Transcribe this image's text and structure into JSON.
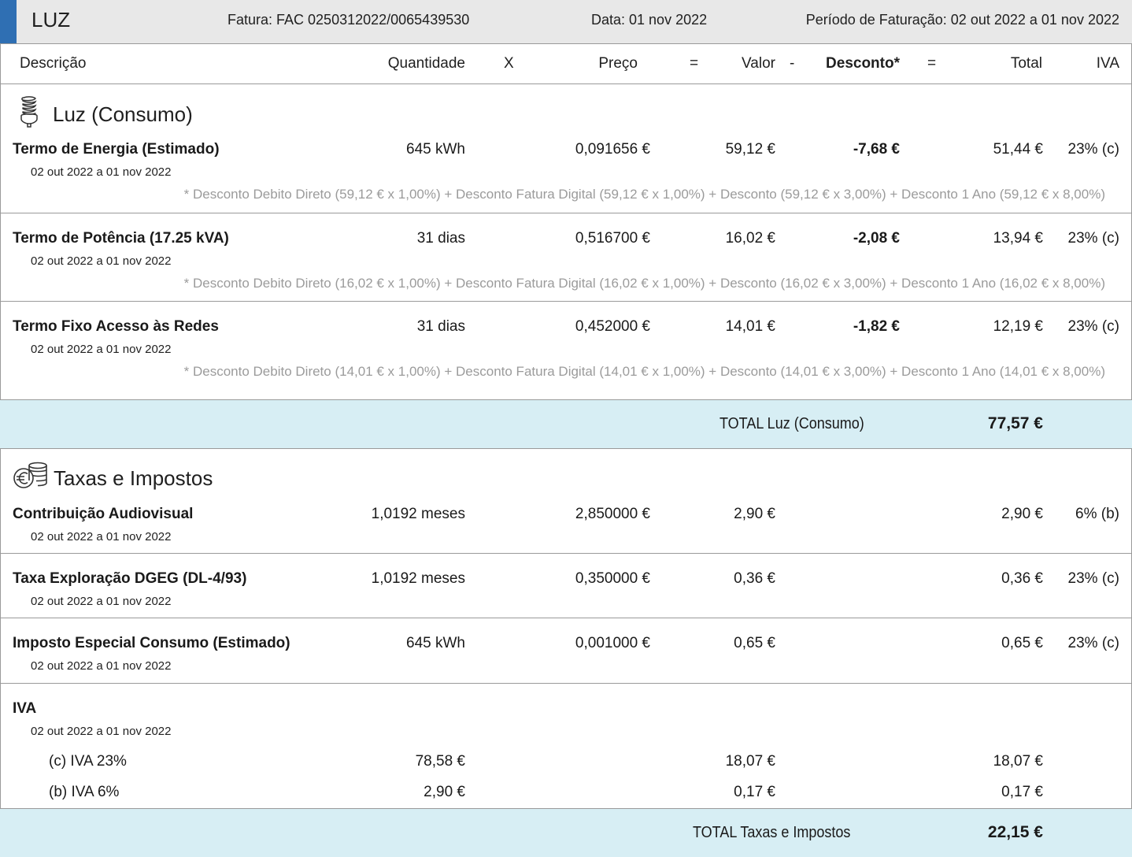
{
  "header": {
    "title": "LUZ",
    "invoice": "Fatura: FAC 0250312022/0065439530",
    "date": "Data: 01 nov 2022",
    "period": "Período de Faturação:  02 out 2022 a 01 nov 2022"
  },
  "columns": {
    "description": "Descrição",
    "quantity": "Quantidade",
    "times": "X",
    "price": "Preço",
    "eq1": "=",
    "value": "Valor",
    "minus": "-",
    "discount": "Desconto*",
    "eq2": "=",
    "total": "Total",
    "iva": "IVA"
  },
  "consumo": {
    "title": "Luz (Consumo)",
    "icon": "lightbulb-icon",
    "rows": [
      {
        "name": "Termo de Energia (Estimado)",
        "period": "02 out 2022 a 01 nov 2022",
        "quantity": "645 kWh",
        "price": "0,091656 €",
        "value": "59,12 €",
        "discount": "-7,68 €",
        "total": "51,44 €",
        "iva": "23% (c)",
        "note": "* Desconto Debito Direto (59,12 € x 1,00%) + Desconto Fatura Digital (59,12 € x 1,00%) + Desconto (59,12 € x 3,00%) + Desconto 1 Ano (59,12 € x 8,00%)"
      },
      {
        "name": "Termo de Potência (17.25 kVA)",
        "period": "02 out 2022 a 01 nov 2022",
        "quantity": "31 dias",
        "price": "0,516700 €",
        "value": "16,02 €",
        "discount": "-2,08 €",
        "total": "13,94 €",
        "iva": "23% (c)",
        "note": "* Desconto Debito Direto (16,02 € x 1,00%) + Desconto Fatura Digital (16,02 € x 1,00%) + Desconto (16,02 € x 3,00%) + Desconto 1 Ano (16,02 € x 8,00%)"
      },
      {
        "name": "Termo Fixo Acesso às Redes",
        "period": "02 out 2022 a 01 nov 2022",
        "quantity": "31 dias",
        "price": "0,452000 €",
        "value": "14,01 €",
        "discount": "-1,82 €",
        "total": "12,19 €",
        "iva": "23% (c)",
        "note": "* Desconto Debito Direto (14,01 € x 1,00%) + Desconto Fatura Digital (14,01 € x 1,00%) + Desconto (14,01 € x 3,00%) + Desconto 1 Ano (14,01 € x 8,00%)"
      }
    ],
    "total_label": "TOTAL Luz (Consumo)",
    "total_value": "77,57 €"
  },
  "taxas": {
    "title": "Taxas e Impostos",
    "icon": "euro-coins-icon",
    "rows": [
      {
        "name": "Contribuição Audiovisual",
        "period": "02 out 2022 a 01 nov 2022",
        "quantity": "1,0192 meses",
        "price": "2,850000 €",
        "value": "2,90 €",
        "total": "2,90 €",
        "iva": "6% (b)"
      },
      {
        "name": "Taxa Exploração DGEG (DL-4/93)",
        "period": "02 out 2022 a 01 nov 2022",
        "quantity": "1,0192 meses",
        "price": "0,350000 €",
        "value": "0,36 €",
        "total": "0,36 €",
        "iva": "23% (c)"
      },
      {
        "name": "Imposto Especial Consumo (Estimado)",
        "period": "02 out 2022 a 01 nov 2022",
        "quantity": "645 kWh",
        "price": "0,001000 €",
        "value": "0,65 €",
        "total": "0,65 €",
        "iva": "23% (c)"
      }
    ],
    "iva": {
      "name": "IVA",
      "period": "02 out 2022 a 01 nov 2022",
      "lines": [
        {
          "label": "(c) IVA 23%",
          "base": "78,58 €",
          "value": "18,07 €",
          "total": "18,07 €"
        },
        {
          "label": "(b) IVA 6%",
          "base": "2,90 €",
          "value": "0,17 €",
          "total": "0,17 €"
        }
      ]
    },
    "total_label": "TOTAL Taxas e Impostos",
    "total_value": "22,15 €"
  }
}
